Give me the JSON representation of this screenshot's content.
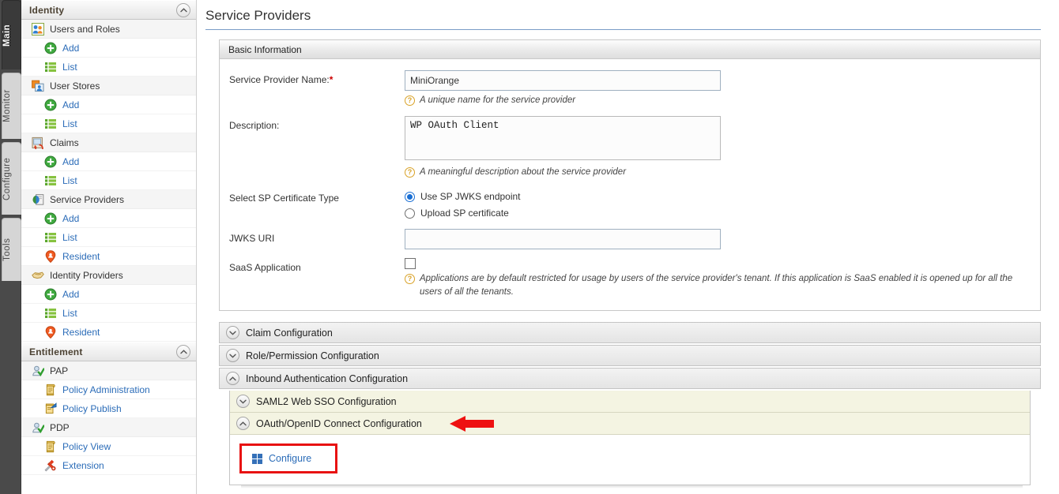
{
  "rail": {
    "tabs": [
      {
        "label": "Main",
        "active": true
      },
      {
        "label": "Monitor",
        "active": false
      },
      {
        "label": "Configure",
        "active": false
      },
      {
        "label": "Tools",
        "active": false
      }
    ]
  },
  "sidebar": {
    "groups": [
      {
        "title": "Identity",
        "collapse_icon": "chevron-up-icon",
        "items": [
          {
            "label": "Users and Roles",
            "icon": "users-icon",
            "level": "parent"
          },
          {
            "label": "Add",
            "icon": "add-green-icon",
            "level": "child"
          },
          {
            "label": "List",
            "icon": "list-green-icon",
            "level": "child"
          },
          {
            "label": "User Stores",
            "icon": "user-stores-icon",
            "level": "parent"
          },
          {
            "label": "Add",
            "icon": "add-green-icon",
            "level": "child"
          },
          {
            "label": "List",
            "icon": "list-green-icon",
            "level": "child"
          },
          {
            "label": "Claims",
            "icon": "claims-icon",
            "level": "parent"
          },
          {
            "label": "Add",
            "icon": "add-green-icon",
            "level": "child"
          },
          {
            "label": "List",
            "icon": "list-green-icon",
            "level": "child"
          },
          {
            "label": "Service Providers",
            "icon": "service-providers-icon",
            "level": "parent"
          },
          {
            "label": "Add",
            "icon": "add-green-icon",
            "level": "child"
          },
          {
            "label": "List",
            "icon": "list-green-icon",
            "level": "child"
          },
          {
            "label": "Resident",
            "icon": "resident-pin-icon",
            "level": "child"
          },
          {
            "label": "Identity Providers",
            "icon": "identity-providers-icon",
            "level": "parent"
          },
          {
            "label": "Add",
            "icon": "add-green-icon",
            "level": "child"
          },
          {
            "label": "List",
            "icon": "list-green-icon",
            "level": "child"
          },
          {
            "label": "Resident",
            "icon": "resident-pin-icon",
            "level": "child"
          }
        ]
      },
      {
        "title": "Entitlement",
        "collapse_icon": "chevron-up-icon",
        "items": [
          {
            "label": "PAP",
            "icon": "pap-icon",
            "level": "parent"
          },
          {
            "label": "Policy Administration",
            "icon": "policy-scroll-icon",
            "level": "child"
          },
          {
            "label": "Policy Publish",
            "icon": "policy-publish-icon",
            "level": "child"
          },
          {
            "label": "PDP",
            "icon": "pdp-icon",
            "level": "parent"
          },
          {
            "label": "Policy View",
            "icon": "policy-scroll-icon",
            "level": "child"
          },
          {
            "label": "Extension",
            "icon": "extension-icon",
            "level": "child"
          }
        ]
      }
    ]
  },
  "main": {
    "page_title": "Service Providers",
    "basic_panel": {
      "heading": "Basic Information",
      "fields": {
        "sp_name_label": "Service Provider Name:",
        "sp_name_required_marker": "*",
        "sp_name_value": "MiniOrange",
        "sp_name_hint": "A unique name for the service provider",
        "description_label": "Description:",
        "description_value": "WP OAuth Client",
        "description_hint": "A meaningful description about the service provider",
        "cert_type_label": "Select SP Certificate Type",
        "cert_option_jwks": "Use SP JWKS endpoint",
        "cert_option_upload": "Upload SP certificate",
        "cert_selected": "Use SP JWKS endpoint",
        "jwks_uri_label": "JWKS URI",
        "jwks_uri_value": "",
        "saas_label": "SaaS Application",
        "saas_checked": false,
        "saas_hint": "Applications are by default restricted for usage by users of the service provider's tenant. If this application is SaaS enabled it is opened up for all the users of all the tenants."
      }
    },
    "sections": [
      {
        "title": "Claim Configuration",
        "expanded": false,
        "icon": "chevron-down-icon"
      },
      {
        "title": "Role/Permission Configuration",
        "expanded": false,
        "icon": "chevron-down-icon"
      },
      {
        "title": "Inbound Authentication Configuration",
        "expanded": true,
        "icon": "chevron-up-icon"
      }
    ],
    "inbound": {
      "subsections": [
        {
          "title": "SAML2 Web SSO Configuration",
          "expanded": false,
          "icon": "chevron-down-icon"
        },
        {
          "title": "OAuth/OpenID Connect Configuration",
          "expanded": true,
          "icon": "chevron-up-icon"
        }
      ],
      "configure_label": "Configure",
      "configure_icon": "grid-squares-icon"
    },
    "annotations": {
      "arrow_color": "#ee1111",
      "highlight_box_color": "#e81212",
      "arrow_target": "OAuth/OpenID Connect Configuration",
      "highlight_target": "Configure"
    }
  }
}
